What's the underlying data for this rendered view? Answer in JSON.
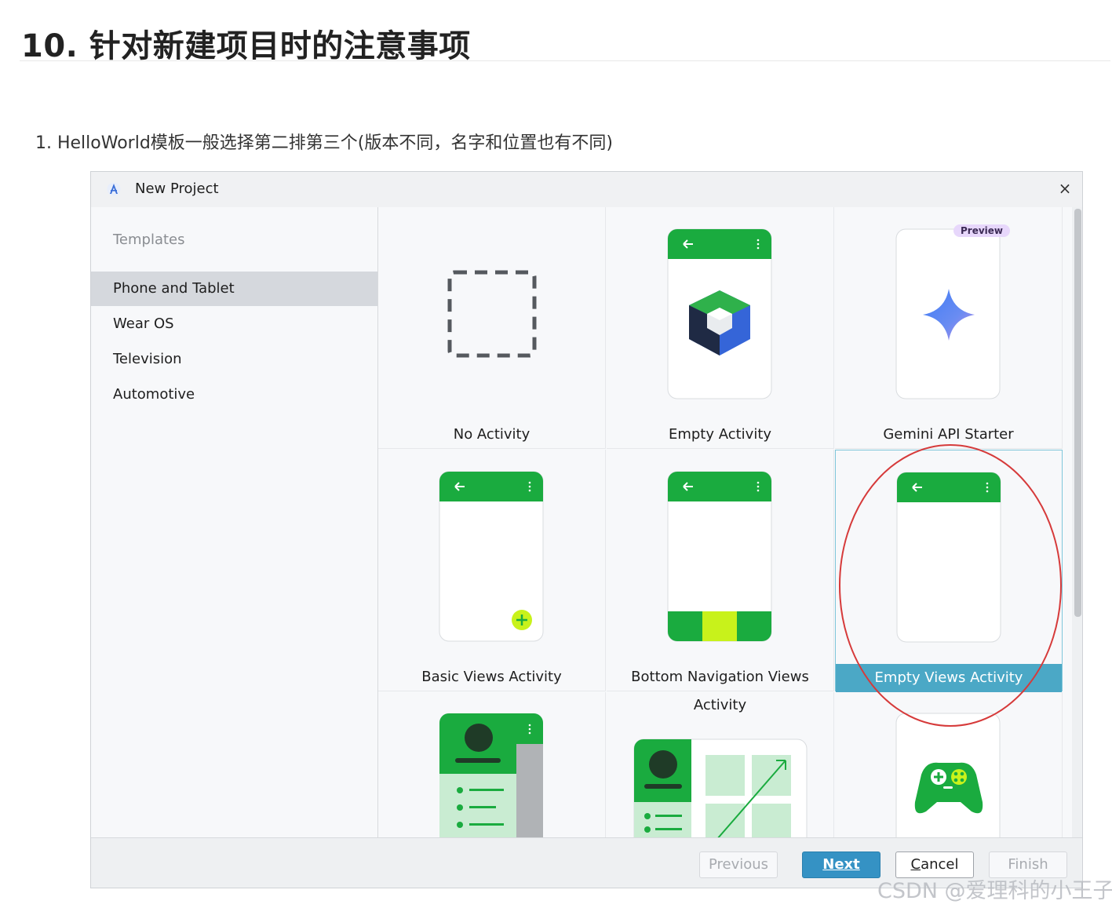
{
  "article": {
    "heading": "10. 针对新建项目时的注意事项",
    "list_item": "1. HelloWorld模板一般选择第二排第三个(版本不同，名字和位置也有不同)"
  },
  "dialog": {
    "title": "New Project",
    "close_glyph": "×",
    "sidebar": {
      "header": "Templates",
      "items": [
        "Phone and Tablet",
        "Wear OS",
        "Television",
        "Automotive"
      ],
      "selected": "Phone and Tablet"
    },
    "templates": [
      {
        "label": "No Activity",
        "icon": "dashed-square-icon"
      },
      {
        "label": "Empty Activity",
        "icon": "compose-cube-icon"
      },
      {
        "label": "Gemini API Starter",
        "icon": "gemini-sparkle-icon",
        "badge": "Preview"
      },
      {
        "label": "Basic Views Activity",
        "icon": "phone-fab-icon"
      },
      {
        "label": "Bottom Navigation Views Activity",
        "icon": "phone-bottom-nav-icon"
      },
      {
        "label": "Empty Views Activity",
        "icon": "phone-blank-icon",
        "selected": true
      },
      {
        "label": "",
        "icon": "master-detail-icon"
      },
      {
        "label": "",
        "icon": "responsive-grid-icon"
      },
      {
        "label": "",
        "icon": "game-controller-icon"
      }
    ],
    "footer": {
      "previous": "Previous",
      "next": "Next",
      "cancel_mnemonic": "C",
      "cancel_rest": "ancel",
      "finish": "Finish"
    }
  },
  "watermark": "CSDN @爱理科的小王子",
  "colors": {
    "android_green": "#1aab3f",
    "lime": "#c8f21b",
    "selection_blue": "#4ba8c6",
    "primary_button": "#3592c4",
    "annotation_red": "#d63a3a"
  }
}
